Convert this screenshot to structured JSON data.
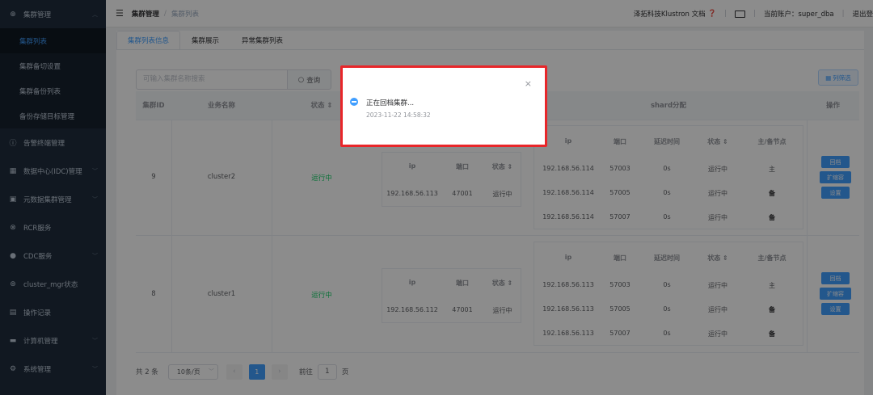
{
  "sidebar": {
    "group_title": "集群管理",
    "sub_items": [
      "集群列表",
      "集群备切设置",
      "集群备份列表",
      "备份存储目标管理"
    ],
    "menu": [
      {
        "label": "告警终端管理",
        "icon": "alert-circle-icon"
      },
      {
        "label": "数据中心(IDC)管理",
        "icon": "datacenter-icon"
      },
      {
        "label": "元数据集群管理",
        "icon": "metadata-icon"
      },
      {
        "label": "RCR服务",
        "icon": "link-icon"
      },
      {
        "label": "CDC服务",
        "icon": "user-icon"
      },
      {
        "label": "cluster_mgr状态",
        "icon": "settings-circle-icon"
      },
      {
        "label": "操作记录",
        "icon": "record-icon"
      },
      {
        "label": "计算机管理",
        "icon": "computer-icon"
      },
      {
        "label": "系统管理",
        "icon": "gear-icon"
      }
    ]
  },
  "header": {
    "breadcrumb_root": "集群管理",
    "breadcrumb_current": "集群列表",
    "docs_link": "泽拓科技Klustron 文档",
    "account_label": "当前账户：super_dba",
    "logout": "退出登"
  },
  "tabs": [
    "集群列表信息",
    "集群展示",
    "异常集群列表"
  ],
  "toolbar": {
    "search_placeholder": "可输入集群名称搜索",
    "search_button": "查询",
    "column_filter": "列筛选"
  },
  "table": {
    "headers": {
      "id": "集群ID",
      "name": "业务名称",
      "status": "状态",
      "shard": "shard分配",
      "action": "操作"
    },
    "sub_headers": {
      "ip": "ip",
      "port": "端口",
      "status": "状态",
      "delay": "延迟时间",
      "role": "主/备节点"
    },
    "rows": [
      {
        "id": "9",
        "name": "cluster2",
        "status": "运行中",
        "comp": {
          "ip": "192.168.56.113",
          "port": "47001",
          "status": "运行中"
        },
        "shards": [
          {
            "ip": "192.168.56.114",
            "port": "57003",
            "delay": "0s",
            "status": "运行中",
            "role": "主"
          },
          {
            "ip": "192.168.56.114",
            "port": "57005",
            "delay": "0s",
            "status": "运行中",
            "role": "备"
          },
          {
            "ip": "192.168.56.114",
            "port": "57007",
            "delay": "0s",
            "status": "运行中",
            "role": "备"
          }
        ],
        "actions": [
          "回档",
          "扩缩容",
          "设置"
        ]
      },
      {
        "id": "8",
        "name": "cluster1",
        "status": "运行中",
        "comp": {
          "ip": "192.168.56.112",
          "port": "47001",
          "status": "运行中"
        },
        "shards": [
          {
            "ip": "192.168.56.113",
            "port": "57003",
            "delay": "0s",
            "status": "运行中",
            "role": "主"
          },
          {
            "ip": "192.168.56.113",
            "port": "57005",
            "delay": "0s",
            "status": "运行中",
            "role": "备"
          },
          {
            "ip": "192.168.56.113",
            "port": "57007",
            "delay": "0s",
            "status": "运行中",
            "role": "备"
          }
        ],
        "actions": [
          "回档",
          "扩缩容",
          "设置"
        ]
      }
    ]
  },
  "pagination": {
    "total": "共 2 条",
    "page_size": "10条/页",
    "current_page": "1",
    "goto_label": "前往",
    "goto_value": "1",
    "page_suffix": "页"
  },
  "notification": {
    "message": "正在回档集群...",
    "time": "2023-11-22 14:58:32"
  }
}
